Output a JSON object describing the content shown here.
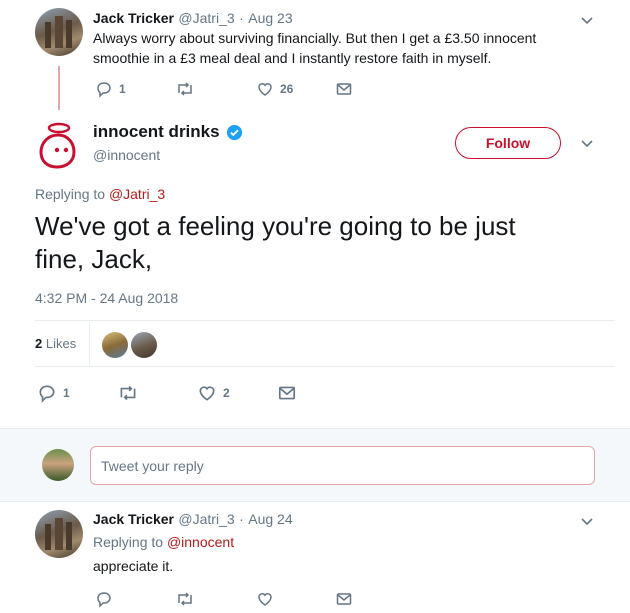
{
  "parent_tweet": {
    "name": "Jack Tricker",
    "handle": "@Jatri_3",
    "separator": "·",
    "date": "Aug 23",
    "text_line1": "Always worry about surviving financially. But then I get a £3.50 innocent",
    "text_line2": "smoothie in a £3 meal deal and I instantly restore faith in myself.",
    "reply_count": "1",
    "like_count": "26"
  },
  "main_tweet": {
    "name": "innocent drinks",
    "handle": "@innocent",
    "follow_label": "Follow",
    "replying_prefix": "Replying to",
    "replying_handle": "@Jatri_3",
    "text_line1": "We've got a feeling you're going to be just",
    "text_line2": "fine, Jack,",
    "timestamp": "4:32 PM - 24 Aug 2018",
    "likes_count": "2",
    "likes_label": "Likes",
    "reply_count": "1",
    "like_count": "2"
  },
  "reply_box": {
    "placeholder": "Tweet your reply"
  },
  "reply_tweet": {
    "name": "Jack Tricker",
    "handle": "@Jatri_3",
    "separator": "·",
    "date": "Aug 24",
    "replying_prefix": "Replying to",
    "replying_handle": "@innocent",
    "text": "appreciate it."
  },
  "colors": {
    "brand": "#c8102e",
    "link": "#b51c1c",
    "muted": "#657786",
    "verified": "#1da1f2",
    "thread_line": "#e0a8a8"
  },
  "icons": [
    "reply-icon",
    "retweet-icon",
    "like-icon",
    "message-icon",
    "chevron-down-icon",
    "verified-badge-icon",
    "innocent-logo"
  ]
}
